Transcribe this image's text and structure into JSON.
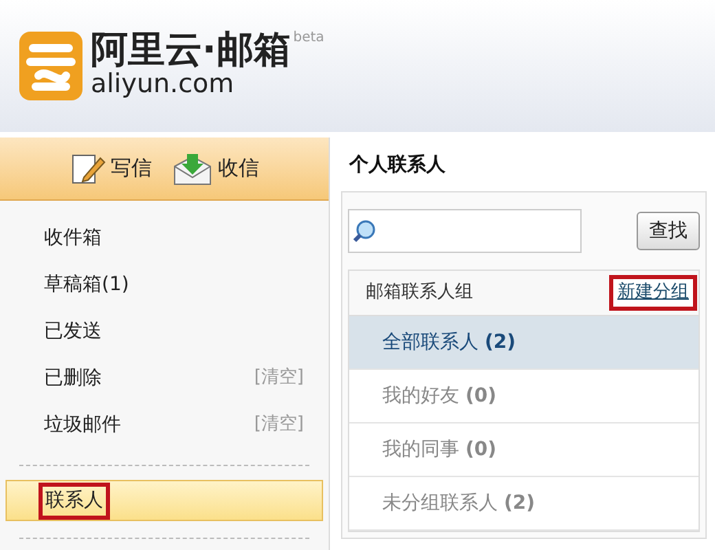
{
  "logo": {
    "name": "阿里云·邮箱",
    "badge": "beta",
    "domain": "aliyun.com"
  },
  "toolbar": [
    {
      "kind": "compose",
      "label": "写信"
    },
    {
      "kind": "receive",
      "label": "收信"
    }
  ],
  "folders": [
    {
      "label": "收件箱",
      "selected": false,
      "highlighted": false
    },
    {
      "label": "草稿箱(1)",
      "selected": false,
      "highlighted": false
    },
    {
      "label": "已发送",
      "selected": false,
      "highlighted": false
    },
    {
      "label": "已删除",
      "action": "[清空]",
      "selected": false,
      "highlighted": false
    },
    {
      "label": "垃圾邮件",
      "action": "[清空]",
      "selected": false,
      "highlighted": false
    },
    {
      "label": "联系人",
      "selected": true,
      "highlighted": true,
      "separated": true
    }
  ],
  "contacts": {
    "title": "个人联系人",
    "search_button": "查找",
    "group_header": "邮箱联系人组",
    "new_group": {
      "label": "新建分组",
      "highlighted": true
    },
    "groups": [
      {
        "label": "全部联系人",
        "count": "(2)",
        "selected": true
      },
      {
        "label": "我的好友",
        "count": "(0)",
        "selected": false
      },
      {
        "label": "我的同事",
        "count": "(0)",
        "selected": false
      },
      {
        "label": "未分组联系人",
        "count": "(2)",
        "selected": false
      }
    ]
  }
}
